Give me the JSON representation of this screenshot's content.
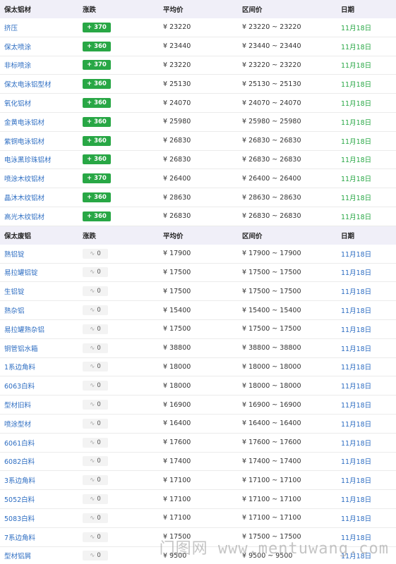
{
  "headers": {
    "col2": "涨跌",
    "col3": "平均价",
    "col4": "区间价",
    "col5": "日期"
  },
  "sections": [
    {
      "title": "保太铝材",
      "trend": "up",
      "rows": [
        {
          "name": "挤压",
          "change": "+ 370",
          "avg": "¥ 23220",
          "range": "¥ 23220 ~ 23220",
          "date": "11月18日"
        },
        {
          "name": "保太喷涂",
          "change": "+ 360",
          "avg": "¥ 23440",
          "range": "¥ 23440 ~ 23440",
          "date": "11月18日"
        },
        {
          "name": "非标喷涂",
          "change": "+ 370",
          "avg": "¥ 23220",
          "range": "¥ 23220 ~ 23220",
          "date": "11月18日"
        },
        {
          "name": "保太电泳铝型材",
          "change": "+ 360",
          "avg": "¥ 25130",
          "range": "¥ 25130 ~ 25130",
          "date": "11月18日"
        },
        {
          "name": "氧化铝材",
          "change": "+ 360",
          "avg": "¥ 24070",
          "range": "¥ 24070 ~ 24070",
          "date": "11月18日"
        },
        {
          "name": "金黄电泳铝材",
          "change": "+ 360",
          "avg": "¥ 25980",
          "range": "¥ 25980 ~ 25980",
          "date": "11月18日"
        },
        {
          "name": "紫铜电泳铝材",
          "change": "+ 360",
          "avg": "¥ 26830",
          "range": "¥ 26830 ~ 26830",
          "date": "11月18日"
        },
        {
          "name": "电泳黑珍珠铝材",
          "change": "+ 360",
          "avg": "¥ 26830",
          "range": "¥ 26830 ~ 26830",
          "date": "11月18日"
        },
        {
          "name": "喷涂木纹铝材",
          "change": "+ 370",
          "avg": "¥ 26400",
          "range": "¥ 26400 ~ 26400",
          "date": "11月18日"
        },
        {
          "name": "晶沐木纹铝材",
          "change": "+ 360",
          "avg": "¥ 28630",
          "range": "¥ 28630 ~ 28630",
          "date": "11月18日"
        },
        {
          "name": "高光木纹铝材",
          "change": "+ 360",
          "avg": "¥ 26830",
          "range": "¥ 26830 ~ 26830",
          "date": "11月18日"
        }
      ]
    },
    {
      "title": "保太废铝",
      "trend": "flat",
      "rows": [
        {
          "name": "熟铝锭",
          "change": "0",
          "avg": "¥ 17900",
          "range": "¥ 17900 ~ 17900",
          "date": "11月18日"
        },
        {
          "name": "易拉罐铝锭",
          "change": "0",
          "avg": "¥ 17500",
          "range": "¥ 17500 ~ 17500",
          "date": "11月18日"
        },
        {
          "name": "生铝锭",
          "change": "0",
          "avg": "¥ 17500",
          "range": "¥ 17500 ~ 17500",
          "date": "11月18日"
        },
        {
          "name": "熟杂铝",
          "change": "0",
          "avg": "¥ 15400",
          "range": "¥ 15400 ~ 15400",
          "date": "11月18日"
        },
        {
          "name": "易拉罐熟杂铝",
          "change": "0",
          "avg": "¥ 17500",
          "range": "¥ 17500 ~ 17500",
          "date": "11月18日"
        },
        {
          "name": "铜管铝水箱",
          "change": "0",
          "avg": "¥ 38800",
          "range": "¥ 38800 ~ 38800",
          "date": "11月18日"
        },
        {
          "name": "1系边角料",
          "change": "0",
          "avg": "¥ 18000",
          "range": "¥ 18000 ~ 18000",
          "date": "11月18日"
        },
        {
          "name": "6063白料",
          "change": "0",
          "avg": "¥ 18000",
          "range": "¥ 18000 ~ 18000",
          "date": "11月18日"
        },
        {
          "name": "型材旧料",
          "change": "0",
          "avg": "¥ 16900",
          "range": "¥ 16900 ~ 16900",
          "date": "11月18日"
        },
        {
          "name": "喷涂型材",
          "change": "0",
          "avg": "¥ 16400",
          "range": "¥ 16400 ~ 16400",
          "date": "11月18日"
        },
        {
          "name": "6061白料",
          "change": "0",
          "avg": "¥ 17600",
          "range": "¥ 17600 ~ 17600",
          "date": "11月18日"
        },
        {
          "name": "6082白料",
          "change": "0",
          "avg": "¥ 17400",
          "range": "¥ 17400 ~ 17400",
          "date": "11月18日"
        },
        {
          "name": "3系边角料",
          "change": "0",
          "avg": "¥ 17100",
          "range": "¥ 17100 ~ 17100",
          "date": "11月18日"
        },
        {
          "name": "5052白料",
          "change": "0",
          "avg": "¥ 17100",
          "range": "¥ 17100 ~ 17100",
          "date": "11月18日"
        },
        {
          "name": "5083白料",
          "change": "0",
          "avg": "¥ 17100",
          "range": "¥ 17100 ~ 17100",
          "date": "11月18日"
        },
        {
          "name": "7系边角料",
          "change": "0",
          "avg": "¥ 17500",
          "range": "¥ 17500 ~ 17500",
          "date": "11月18日"
        },
        {
          "name": "型材铝屑",
          "change": "0",
          "avg": "¥ 9500",
          "range": "¥ 9500 ~ 9500",
          "date": "11月18日"
        }
      ]
    }
  ],
  "watermark": "门图网 www.mentuwang.com",
  "colors": {
    "up": "#28a745",
    "link": "#2d6dc2",
    "header_bg": "#f0eff8"
  }
}
